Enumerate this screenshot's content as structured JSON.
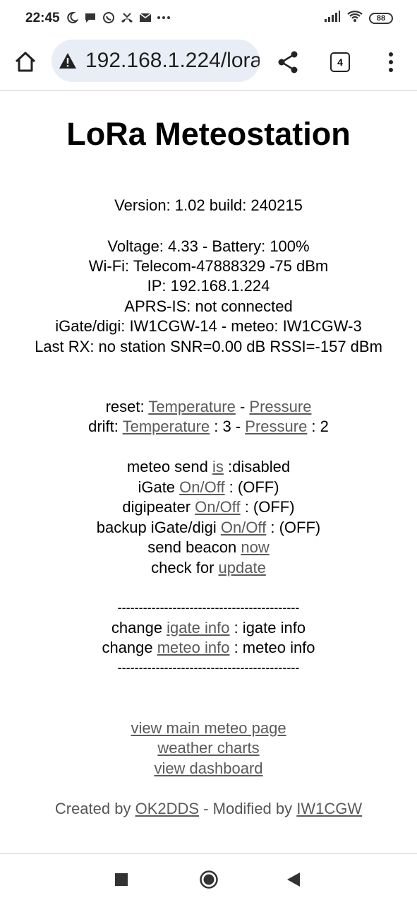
{
  "status_bar": {
    "time": "22:45",
    "left_icons": [
      "moon-icon",
      "chat-bubble-icon",
      "whatsapp-icon",
      "missed-call-icon",
      "mail-icon",
      "more-dots-icon"
    ],
    "battery": "88"
  },
  "browser": {
    "url": "192.168.1.224/lora",
    "tab_count": "4"
  },
  "page": {
    "title": "LoRa Meteostation",
    "version": "Version: 1.02 build: 240215",
    "status_lines": [
      "Voltage: 4.33 - Battery: 100%",
      "Wi-Fi: Telecom-47888329 -75 dBm",
      "IP: 192.168.1.224",
      "APRS-IS: not connected",
      "iGate/digi: IW1CGW-14 - meteo: IW1CGW-3",
      "Last RX: no station SNR=0.00 dB RSSI=-157 dBm"
    ],
    "reset": {
      "prefix": "reset: ",
      "link1": "Temperature",
      "sep": " - ",
      "link2": "Pressure"
    },
    "drift": {
      "prefix": "drift: ",
      "link1": "Temperature",
      "mid": " : 3 - ",
      "link2": "Pressure",
      "suffix": " : 2"
    },
    "meteo_send": {
      "prefix": "meteo send ",
      "link": "is",
      "suffix": " :disabled"
    },
    "igate": {
      "prefix": "iGate ",
      "link": "On/Off",
      "suffix": " : (OFF)"
    },
    "digipeater": {
      "prefix": "digipeater ",
      "link": "On/Off",
      "suffix": " : (OFF)"
    },
    "backup": {
      "prefix": "backup iGate/digi ",
      "link": "On/Off",
      "suffix": " : (OFF)"
    },
    "beacon": {
      "prefix": "send beacon ",
      "link": "now"
    },
    "update": {
      "prefix": "check for ",
      "link": "update"
    },
    "divider": "-------------------------------------------",
    "igate_info": {
      "prefix": "change ",
      "link": "igate info",
      "suffix": " : igate info"
    },
    "meteo_info": {
      "prefix": "change ",
      "link": "meteo info",
      "suffix": " : meteo info"
    },
    "nav_links": [
      "view main meteo page",
      "weather charts",
      "view dashboard"
    ],
    "footer": {
      "prefix": "Created by ",
      "link1": "OK2DDS",
      "mid": " - Modified by ",
      "link2": "IW1CGW"
    }
  }
}
